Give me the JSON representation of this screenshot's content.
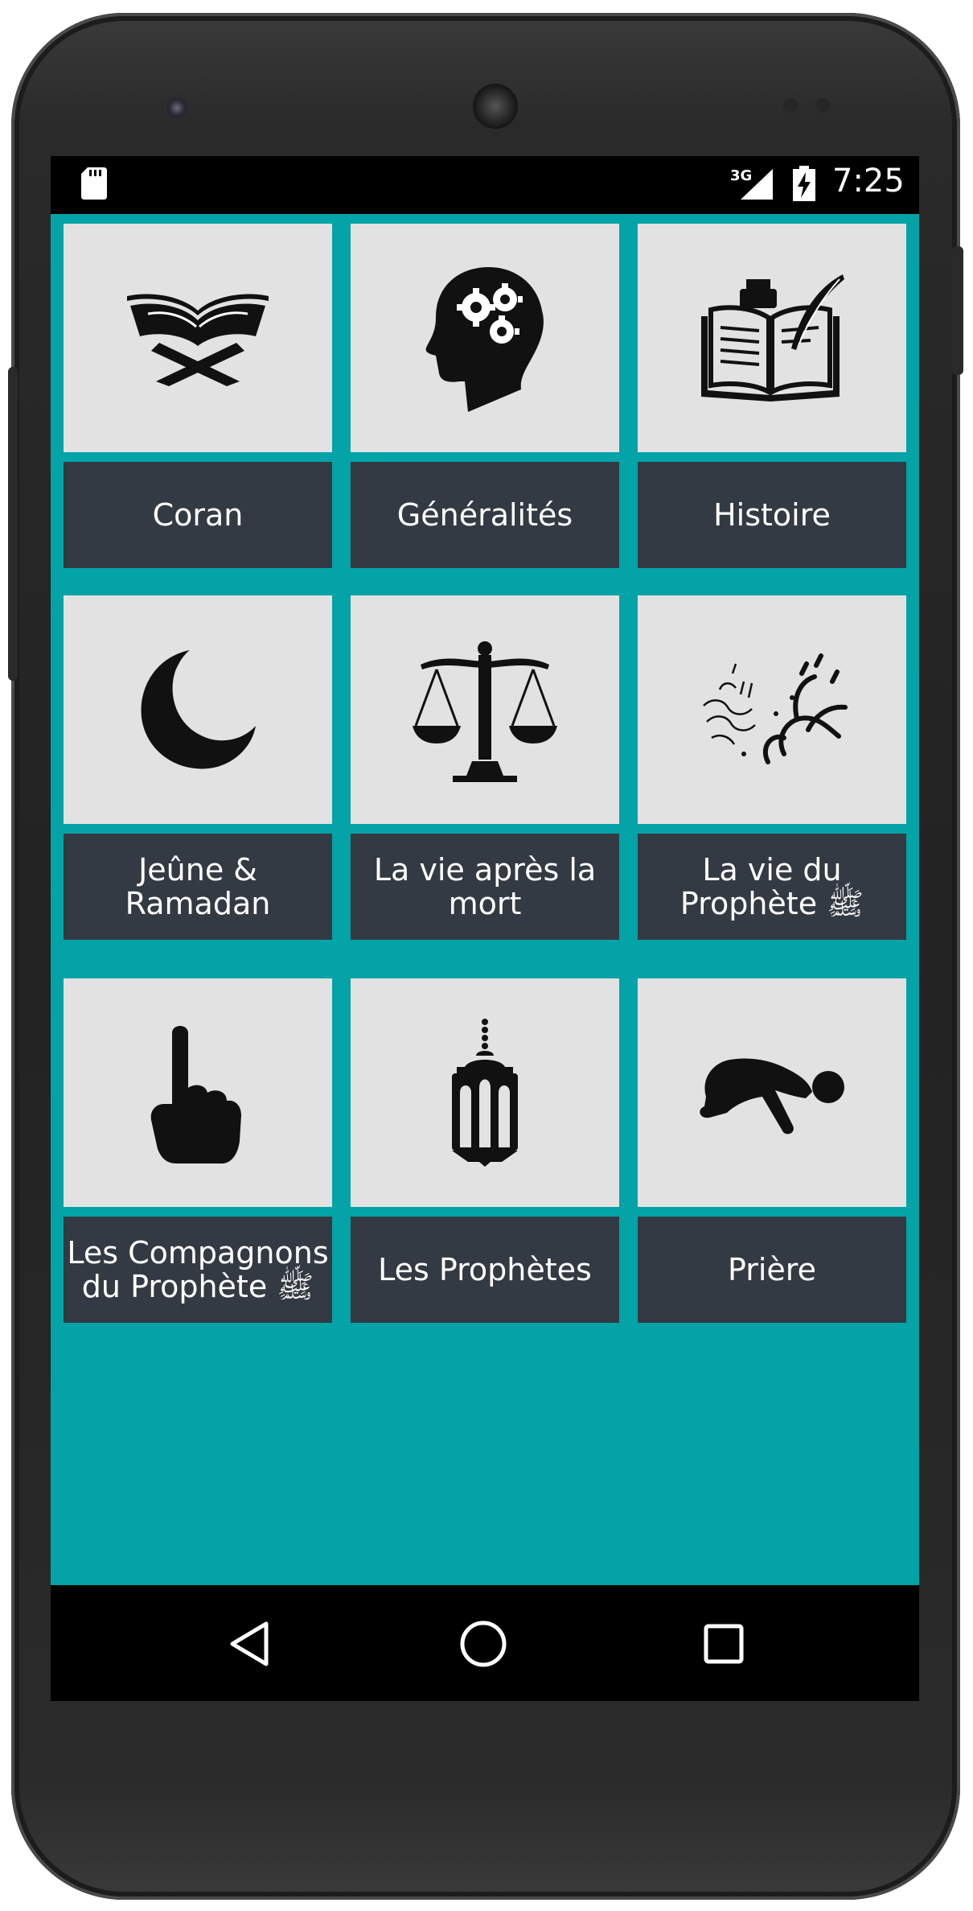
{
  "status_bar": {
    "network": "3G",
    "time": "7:25"
  },
  "tiles": [
    {
      "label": "Coran",
      "icon": "quran-book-icon"
    },
    {
      "label": "Généralités",
      "icon": "head-gears-icon"
    },
    {
      "label": "Histoire",
      "icon": "book-quill-icon"
    },
    {
      "label": "Jeûne &\nRamadan",
      "icon": "crescent-moon-icon"
    },
    {
      "label": "La vie après la\nmort",
      "icon": "scales-icon"
    },
    {
      "label": "La vie du\nProphète ﷺ",
      "icon": "muhammad-calligraphy-icon"
    },
    {
      "label": "Les Compagnons\ndu Prophète ﷺ",
      "icon": "index-finger-icon"
    },
    {
      "label": "Les Prophètes",
      "icon": "lantern-icon"
    },
    {
      "label": "Prière",
      "icon": "prostration-icon"
    }
  ],
  "navbar": {
    "back": "back-icon",
    "home": "home-icon",
    "recents": "recents-icon"
  }
}
